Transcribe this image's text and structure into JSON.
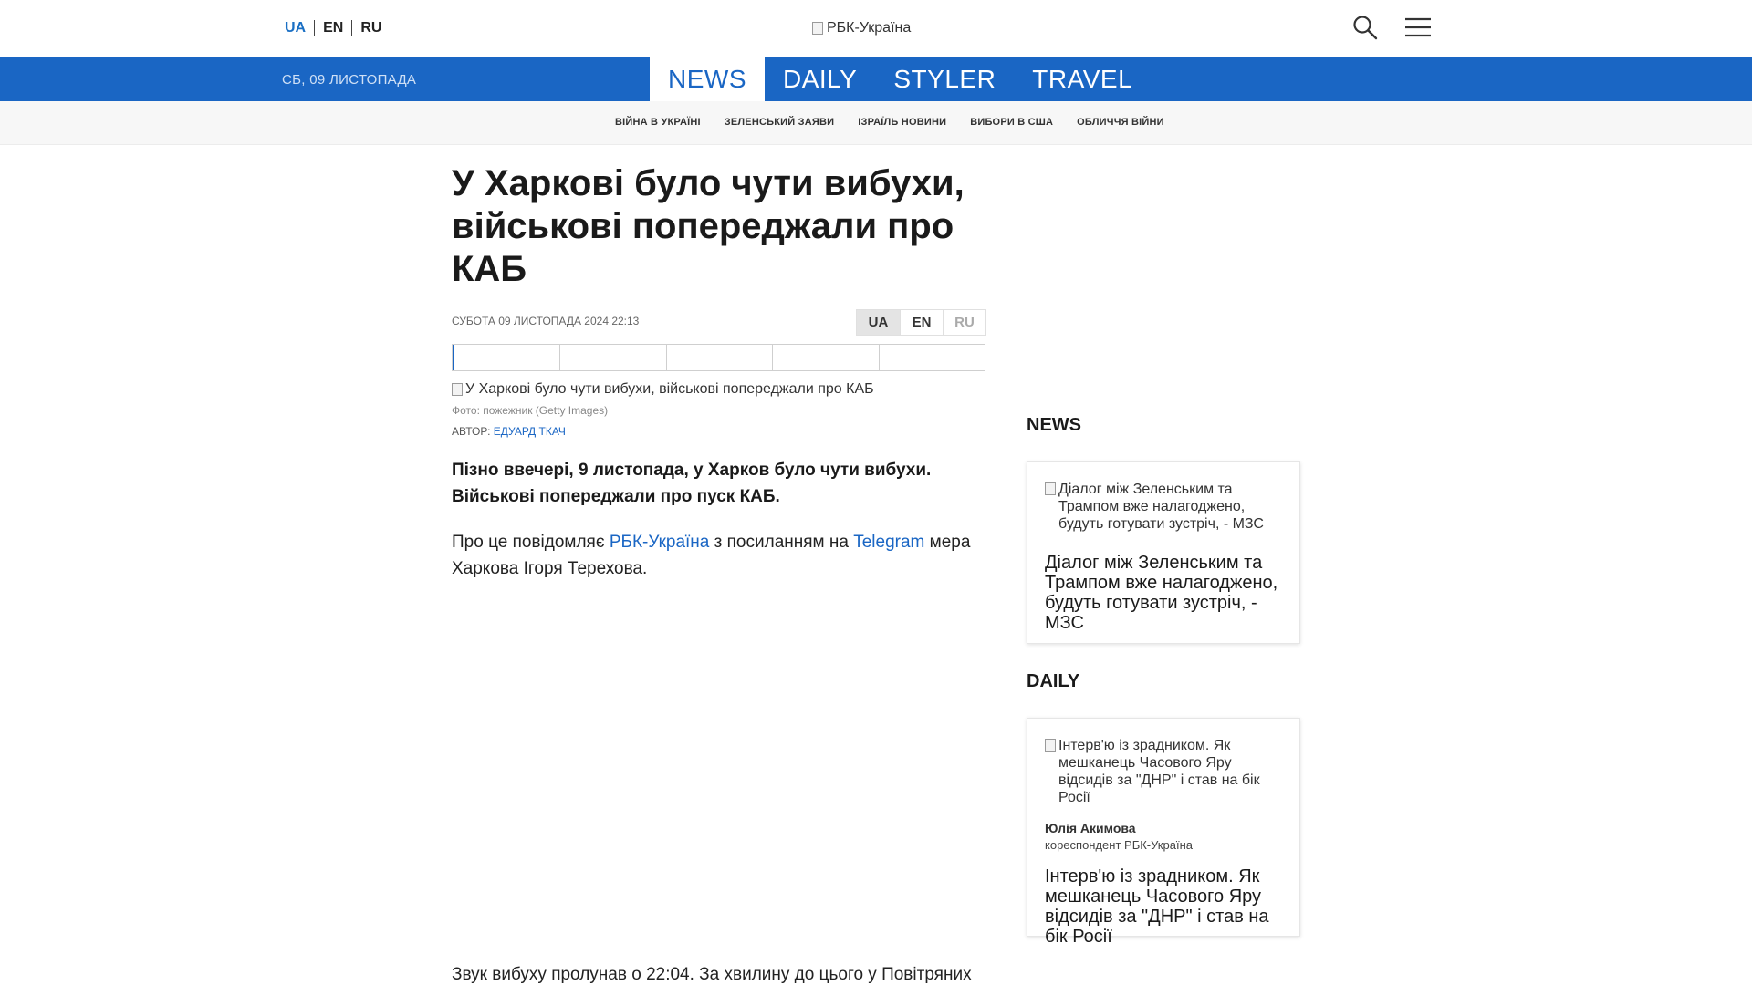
{
  "header": {
    "languages": [
      "UA",
      "EN",
      "RU"
    ],
    "logo_alt": "РБК-Україна"
  },
  "nav": {
    "date": "СБ, 09 ЛИСТОПАДА",
    "tabs": [
      "NEWS",
      "DAILY",
      "STYLER",
      "TRAVEL"
    ]
  },
  "topics": [
    "ВІЙНА В УКРАЇНІ",
    "ЗЕЛЕНСЬКИЙ ЗАЯВИ",
    "ІЗРАЇЛЬ НОВИНИ",
    "ВИБОРИ В США",
    "ОБЛИЧЧЯ ВІЙНИ"
  ],
  "article": {
    "title": "У Харкові було чути вибухи, військові попереджали про КАБ",
    "meta": "СУБОТА 09 ЛИСТОПАДА 2024 22:13",
    "languages": [
      "UA",
      "EN",
      "RU"
    ],
    "image_alt": "У Харкові було чути вибухи, військові попереджали про КАБ",
    "caption": "Фото: пожежник (Getty Images)",
    "author_label": "АВТОР:",
    "author_name": "ЕДУАРД ТКАЧ",
    "lead": "Пізно ввечері, 9 листопада, у Харков було чути вибухи. Військові попереджали про пуск КАБ.",
    "para_start": "Про це повідомляє ",
    "para_link1": "РБК-Україна",
    "para_mid": " з посиланням на ",
    "para_link2": "Telegram",
    "para_end": " мера Харкова Ігоря Терехова.",
    "para2": "Звук вибуху пролунав о 22:04. За хвилину до цього у Повітряних"
  },
  "sidebar": {
    "news": {
      "title": "NEWS",
      "image_alt": "Діалог між Зеленським та Трампом вже налагоджено, будуть готувати зустріч, - МЗС",
      "headline": "Діалог між Зеленським та Трампом вже налагоджено, будуть готувати зустріч, - МЗС"
    },
    "daily": {
      "title": "DAILY",
      "image_alt": "Інтерв'ю із зрадником. Як мешканець Часового Яру відсидів за \"ДНР\" і став на бік Росії",
      "author": "Юлія Акимова",
      "role": "кореспондент РБК-Україна",
      "headline": "Інтерв'ю із зрадником. Як мешканець Часового Яру відсидів за \"ДНР\" і став на бік Росії"
    }
  },
  "colors": {
    "brand_blue": "#1a66c4",
    "topics_bg": "#f7f7f7"
  },
  "icons": {
    "search": "search-icon",
    "menu": "menu-icon"
  }
}
